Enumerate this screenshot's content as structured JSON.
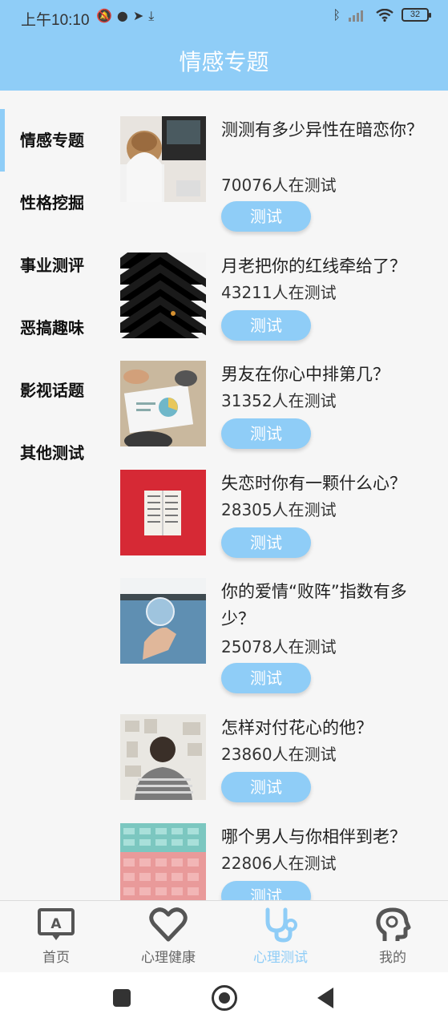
{
  "status_bar": {
    "time": "上午10:10",
    "left_icons": [
      "mute-icon",
      "chat-icon",
      "send-icon",
      "download-icon"
    ],
    "right_icons": [
      "bluetooth-icon",
      "signal-icon",
      "wifi-icon"
    ],
    "battery": "32"
  },
  "header": {
    "title": "情感专题"
  },
  "sidebar": {
    "items": [
      {
        "label": "情感专题",
        "active": true
      },
      {
        "label": "性格挖掘",
        "active": false
      },
      {
        "label": "事业测评",
        "active": false
      },
      {
        "label": "恶搞趣味",
        "active": false
      },
      {
        "label": "影视话题",
        "active": false
      },
      {
        "label": "其他测试",
        "active": false
      }
    ]
  },
  "tests": [
    {
      "title": "测测有多少异性在暗恋你？",
      "count": "70076人在测试",
      "button": "测试",
      "image": "woman-at-laptop"
    },
    {
      "title": "月老把你的红线牵给了？",
      "count": "43211人在测试",
      "button": "测试",
      "image": "zebra-crossing"
    },
    {
      "title": "男友在你心中排第几？",
      "count": "31352人在测试",
      "button": "测试",
      "image": "charts-on-table"
    },
    {
      "title": "失恋时你有一颗什么心？",
      "count": "28305人在测试",
      "button": "测试",
      "image": "book-on-red"
    },
    {
      "title": "你的爱情“败阵”指数有多少？",
      "count": "25078人在测试",
      "button": "测试",
      "image": "crystal-ball"
    },
    {
      "title": "怎样对付花心的他？",
      "count": "23860人在测试",
      "button": "测试",
      "image": "man-at-wall"
    },
    {
      "title": "哪个男人与你相伴到老？",
      "count": "22806人在测试",
      "button": "测试",
      "image": "stadium-seats"
    }
  ],
  "bottom_nav": {
    "tabs": [
      {
        "label": "首页",
        "icon": "home-icon",
        "active": false
      },
      {
        "label": "心理健康",
        "icon": "heart-icon",
        "active": false
      },
      {
        "label": "心理测试",
        "icon": "stethoscope-icon",
        "active": true
      },
      {
        "label": "我的",
        "icon": "profile-head-icon",
        "active": false
      }
    ]
  },
  "colors": {
    "primary": "#8fcdf7",
    "inactive_tab": "#666666"
  }
}
